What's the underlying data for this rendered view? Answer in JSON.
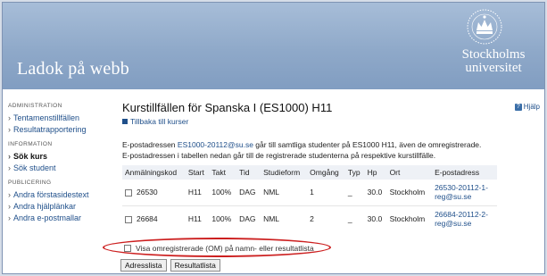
{
  "header": {
    "app_title": "Ladok på webb",
    "brand": [
      "Stockholms",
      "universitet"
    ]
  },
  "sidebar": {
    "sections": [
      {
        "title": "ADMINISTRATION",
        "items": [
          {
            "label": "Tentamenstillfällen"
          },
          {
            "label": "Resultatrapportering"
          }
        ]
      },
      {
        "title": "INFORMATION",
        "items": [
          {
            "label": "Sök kurs",
            "active": true
          },
          {
            "label": "Sök student"
          }
        ]
      },
      {
        "title": "PUBLICERING",
        "items": [
          {
            "label": "Andra förstasidestext"
          },
          {
            "label": "Andra hjälplänkar"
          },
          {
            "label": "Andra e-postmallar"
          }
        ]
      }
    ]
  },
  "main": {
    "title": "Kurstillfällen för Spanska I (ES1000) H11",
    "back_link": "Tillbaka till kurser",
    "help": "Hjälp",
    "info_pre": "E-postadressen ",
    "info_email": "ES1000-20112@su.se",
    "info_post": " går till samtliga studenter på ES1000 H11, även de omregistrerade.",
    "info_line2": "E-postadressen i tabellen nedan går till de registrerade studenterna på respektive kurstillfälle.",
    "table": {
      "headers": [
        "Anmälningskod",
        "Start",
        "Takt",
        "Tid",
        "Studieform",
        "Omgång",
        "Typ",
        "Hp",
        "Ort",
        "E-postadress"
      ],
      "rows": [
        {
          "code": "26530",
          "start": "H11",
          "takt": "100%",
          "tid": "DAG",
          "studieform": "NML",
          "omgang": "1",
          "typ": "_",
          "hp": "30.0",
          "ort": "Stockholm",
          "email1": "26530-20112-1-",
          "email2": "reg@su.se"
        },
        {
          "code": "26684",
          "start": "H11",
          "takt": "100%",
          "tid": "DAG",
          "studieform": "NML",
          "omgang": "2",
          "typ": "_",
          "hp": "30.0",
          "ort": "Stockholm",
          "email1": "26684-20112-2-",
          "email2": "reg@su.se"
        }
      ]
    },
    "checkbox_label": "Visa omregistrerade (OM) på namn- eller resultatlista",
    "buttons": {
      "address": "Adresslista",
      "result": "Resultatlista"
    }
  },
  "colors": {
    "header": "#8fa9c9",
    "link": "#1f4f8a",
    "highlight_ellipse": "#cc1f1f"
  }
}
